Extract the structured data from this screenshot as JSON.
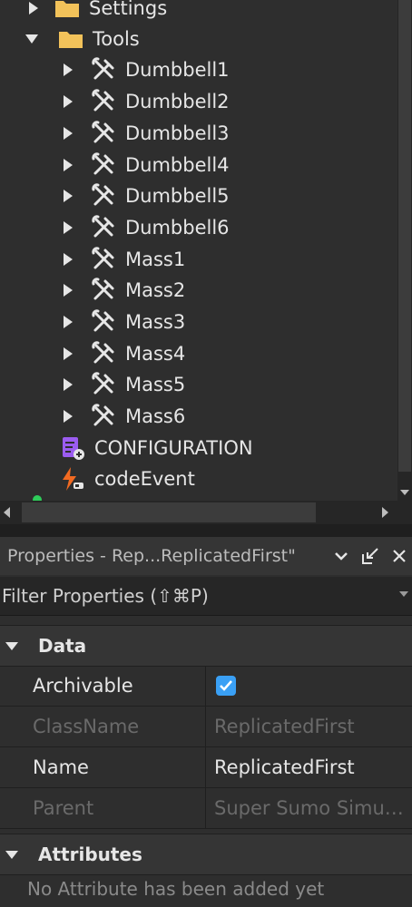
{
  "explorer": {
    "items": [
      {
        "label": "Settings",
        "icon": "folder-icon",
        "expanded": false
      },
      {
        "label": "Tools",
        "icon": "folder-icon",
        "expanded": true
      },
      {
        "label": "Dumbbell1",
        "icon": "tool-icon"
      },
      {
        "label": "Dumbbell2",
        "icon": "tool-icon"
      },
      {
        "label": "Dumbbell3",
        "icon": "tool-icon"
      },
      {
        "label": "Dumbbell4",
        "icon": "tool-icon"
      },
      {
        "label": "Dumbbell5",
        "icon": "tool-icon"
      },
      {
        "label": "Dumbbell6",
        "icon": "tool-icon"
      },
      {
        "label": "Mass1",
        "icon": "tool-icon"
      },
      {
        "label": "Mass2",
        "icon": "tool-icon"
      },
      {
        "label": "Mass3",
        "icon": "tool-icon"
      },
      {
        "label": "Mass4",
        "icon": "tool-icon"
      },
      {
        "label": "Mass5",
        "icon": "tool-icon"
      },
      {
        "label": "Mass6",
        "icon": "tool-icon"
      },
      {
        "label": "CONFIGURATION",
        "icon": "module-script-icon"
      },
      {
        "label": "codeEvent",
        "icon": "remote-event-icon"
      }
    ]
  },
  "properties": {
    "title": "Properties - Rep...ReplicatedFirst\"",
    "filter_placeholder": "Filter Properties (⇧⌘P)",
    "sections": {
      "data": "Data",
      "attributes": "Attributes"
    },
    "rows": [
      {
        "name": "Archivable",
        "value": "",
        "checked": true,
        "disabled": false
      },
      {
        "name": "ClassName",
        "value": "ReplicatedFirst",
        "disabled": true
      },
      {
        "name": "Name",
        "value": "ReplicatedFirst",
        "disabled": false
      },
      {
        "name": "Parent",
        "value": "Super Sumo Simul…",
        "disabled": true
      }
    ],
    "no_attributes": "No Attribute has been added yet"
  },
  "colors": {
    "background": "#2e2e2e",
    "header": "#353535",
    "checkbox": "#3aa0f5",
    "folder": "#f2c25a",
    "module": "#9b5cf0",
    "event": "#f26a21"
  }
}
